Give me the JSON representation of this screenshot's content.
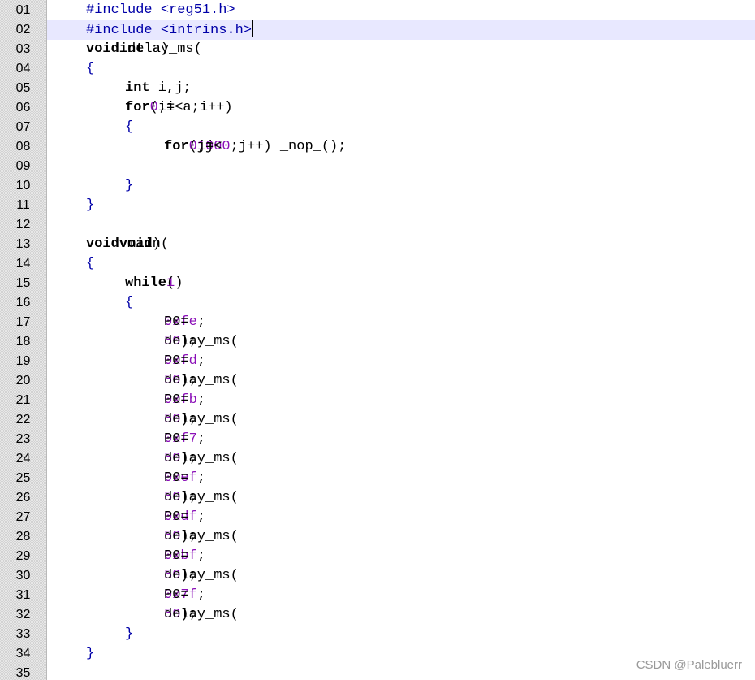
{
  "editor": {
    "colors": {
      "keyword": "#000000",
      "number": "#8b10b8",
      "preprocessor": "#0000a8",
      "current_line_highlight": "#e8e8ff",
      "gutter": "#e7e7e7"
    },
    "current_line": 2,
    "lines": [
      {
        "no": "01",
        "indent": 1,
        "segs": [
          [
            "pp",
            "#include <reg51.h>"
          ]
        ]
      },
      {
        "no": "02",
        "indent": 1,
        "segs": [
          [
            "pp",
            "#include <intrins.h>"
          ]
        ]
      },
      {
        "no": "03",
        "indent": 1,
        "segs": [
          [
            "kw",
            "void"
          ],
          [
            "txt",
            " delay_ms("
          ],
          [
            "kw",
            "int"
          ],
          [
            "txt",
            " a)"
          ]
        ]
      },
      {
        "no": "04",
        "indent": 1,
        "segs": [
          [
            "brace",
            "{"
          ]
        ]
      },
      {
        "no": "05",
        "indent": 2,
        "segs": [
          [
            "kw",
            "int"
          ],
          [
            "txt",
            " i,j;"
          ]
        ]
      },
      {
        "no": "06",
        "indent": 2,
        "segs": [
          [
            "kw",
            "for"
          ],
          [
            "txt",
            "(i="
          ],
          [
            "num",
            "0"
          ],
          [
            "txt",
            ";i<a;i++)"
          ]
        ]
      },
      {
        "no": "07",
        "indent": 2,
        "segs": [
          [
            "brace",
            "{"
          ]
        ]
      },
      {
        "no": "08",
        "indent": 3,
        "segs": [
          [
            "kw",
            "for"
          ],
          [
            "txt",
            "(j="
          ],
          [
            "num",
            "0"
          ],
          [
            "txt",
            ";j<"
          ],
          [
            "num",
            "1000"
          ],
          [
            "txt",
            ";j++) _nop_();"
          ]
        ]
      },
      {
        "no": "09",
        "indent": 0,
        "segs": []
      },
      {
        "no": "10",
        "indent": 2,
        "segs": [
          [
            "brace",
            "}"
          ]
        ]
      },
      {
        "no": "11",
        "indent": 1,
        "segs": [
          [
            "brace",
            "}"
          ]
        ]
      },
      {
        "no": "12",
        "indent": 0,
        "segs": []
      },
      {
        "no": "13",
        "indent": 1,
        "segs": [
          [
            "kw",
            "void"
          ],
          [
            "txt",
            " main("
          ],
          [
            "kw",
            "void"
          ],
          [
            "txt",
            ")"
          ]
        ]
      },
      {
        "no": "14",
        "indent": 1,
        "segs": [
          [
            "brace",
            "{"
          ]
        ]
      },
      {
        "no": "15",
        "indent": 2,
        "segs": [
          [
            "kw",
            "while"
          ],
          [
            "txt",
            "("
          ],
          [
            "num",
            "1"
          ],
          [
            "txt",
            ")"
          ]
        ]
      },
      {
        "no": "16",
        "indent": 2,
        "segs": [
          [
            "brace",
            "{"
          ]
        ]
      },
      {
        "no": "17",
        "indent": 3,
        "segs": [
          [
            "txt",
            "P0="
          ],
          [
            "num",
            "0xfe"
          ],
          [
            "txt",
            ";"
          ]
        ]
      },
      {
        "no": "18",
        "indent": 3,
        "segs": [
          [
            "txt",
            "delay_ms("
          ],
          [
            "num",
            "50"
          ],
          [
            "txt",
            ");"
          ]
        ]
      },
      {
        "no": "19",
        "indent": 3,
        "segs": [
          [
            "txt",
            "P0="
          ],
          [
            "num",
            "0xfd"
          ],
          [
            "txt",
            ";"
          ]
        ]
      },
      {
        "no": "20",
        "indent": 3,
        "segs": [
          [
            "txt",
            "delay_ms("
          ],
          [
            "num",
            "50"
          ],
          [
            "txt",
            ");"
          ]
        ]
      },
      {
        "no": "21",
        "indent": 3,
        "segs": [
          [
            "txt",
            "P0="
          ],
          [
            "num",
            "0xfb"
          ],
          [
            "txt",
            ";"
          ]
        ]
      },
      {
        "no": "22",
        "indent": 3,
        "segs": [
          [
            "txt",
            "delay_ms("
          ],
          [
            "num",
            "50"
          ],
          [
            "txt",
            ");"
          ]
        ]
      },
      {
        "no": "23",
        "indent": 3,
        "segs": [
          [
            "txt",
            "P0="
          ],
          [
            "num",
            "0xf7"
          ],
          [
            "txt",
            ";"
          ]
        ]
      },
      {
        "no": "24",
        "indent": 3,
        "segs": [
          [
            "txt",
            "delay_ms("
          ],
          [
            "num",
            "50"
          ],
          [
            "txt",
            ");"
          ]
        ]
      },
      {
        "no": "25",
        "indent": 3,
        "segs": [
          [
            "txt",
            "P0="
          ],
          [
            "num",
            "0xef"
          ],
          [
            "txt",
            ";"
          ]
        ]
      },
      {
        "no": "26",
        "indent": 3,
        "segs": [
          [
            "txt",
            "delay_ms("
          ],
          [
            "num",
            "50"
          ],
          [
            "txt",
            ");"
          ]
        ]
      },
      {
        "no": "27",
        "indent": 3,
        "segs": [
          [
            "txt",
            "P0="
          ],
          [
            "num",
            "0xdf"
          ],
          [
            "txt",
            ";"
          ]
        ]
      },
      {
        "no": "28",
        "indent": 3,
        "segs": [
          [
            "txt",
            "delay_ms("
          ],
          [
            "num",
            "50"
          ],
          [
            "txt",
            ");"
          ]
        ]
      },
      {
        "no": "29",
        "indent": 3,
        "segs": [
          [
            "txt",
            "P0="
          ],
          [
            "num",
            "0xbf"
          ],
          [
            "txt",
            ";"
          ]
        ]
      },
      {
        "no": "30",
        "indent": 3,
        "segs": [
          [
            "txt",
            "delay_ms("
          ],
          [
            "num",
            "50"
          ],
          [
            "txt",
            ");"
          ]
        ]
      },
      {
        "no": "31",
        "indent": 3,
        "segs": [
          [
            "txt",
            "P0="
          ],
          [
            "num",
            "0x7f"
          ],
          [
            "txt",
            ";"
          ]
        ]
      },
      {
        "no": "32",
        "indent": 3,
        "segs": [
          [
            "txt",
            "delay_ms("
          ],
          [
            "num",
            "50"
          ],
          [
            "txt",
            ");"
          ]
        ]
      },
      {
        "no": "33",
        "indent": 2,
        "segs": [
          [
            "brace",
            "}"
          ]
        ]
      },
      {
        "no": "34",
        "indent": 1,
        "segs": [
          [
            "brace",
            "}"
          ]
        ]
      },
      {
        "no": "35",
        "indent": 0,
        "segs": []
      }
    ]
  },
  "watermark": "CSDN @Palebluerr"
}
